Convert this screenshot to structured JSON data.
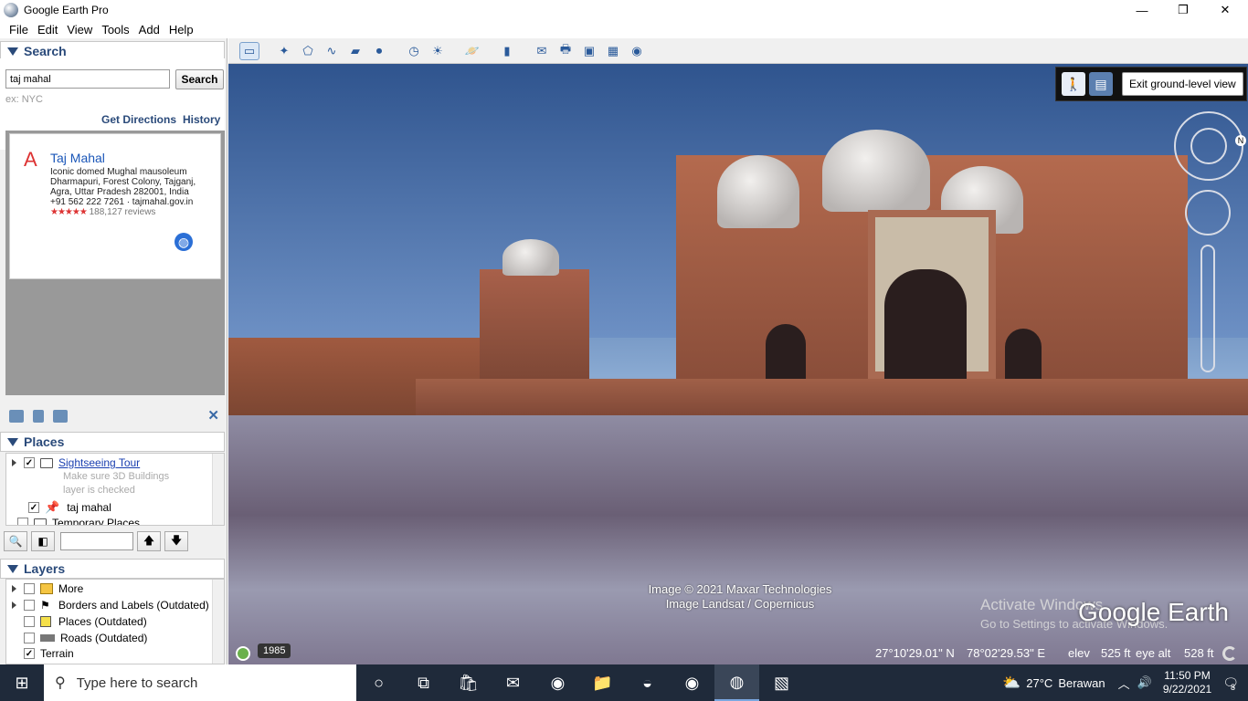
{
  "window": {
    "title": "Google Earth Pro",
    "minimize": "—",
    "maximize": "❐",
    "close": "✕"
  },
  "menu": [
    "File",
    "Edit",
    "View",
    "Tools",
    "Add",
    "Help"
  ],
  "search": {
    "header": "Search",
    "query": "taj mahal",
    "button": "Search",
    "hint": "ex: NYC",
    "get_directions": "Get Directions",
    "history": "History",
    "result": {
      "marker": "A",
      "title": "Taj Mahal",
      "lines": [
        "Iconic domed Mughal mausoleum",
        "Dharmapuri, Forest Colony, Tajganj,",
        "Agra, Uttar Pradesh 282001, India",
        "+91 562 222 7261 · tajmahal.gov.in"
      ],
      "stars": "★★★★★",
      "reviews": "188,127 reviews"
    }
  },
  "places": {
    "header": "Places",
    "items": [
      {
        "label": "Sightseeing Tour",
        "note1": "Make sure 3D Buildings",
        "note2": "layer is checked"
      },
      {
        "label": "taj mahal"
      },
      {
        "label": "Temporary Places"
      }
    ]
  },
  "layers": {
    "header": "Layers",
    "items": [
      "More",
      "Borders and Labels (Outdated)",
      "Places (Outdated)",
      "Roads (Outdated)",
      "Terrain"
    ]
  },
  "viewer": {
    "exit_ground_level": "Exit ground-level view",
    "credit1": "Image © 2021 Maxar Technologies",
    "credit2": "Image Landsat / Copernicus",
    "watermark1": "Activate Windows",
    "watermark2": "Go to Settings to activate Windows.",
    "logo": "Google Earth",
    "year": "1985",
    "lat": "27°10'29.01\" N",
    "lon": "78°02'29.53\" E",
    "elev_label": "elev",
    "elev": "525 ft",
    "eyealt_label": "eye alt",
    "eyealt": "528 ft"
  },
  "taskbar": {
    "search_placeholder": "Type here to search",
    "weather_temp": "27°C",
    "weather_desc": "Berawan",
    "time": "11:50 PM",
    "date": "9/22/2021",
    "notifications": "8"
  }
}
